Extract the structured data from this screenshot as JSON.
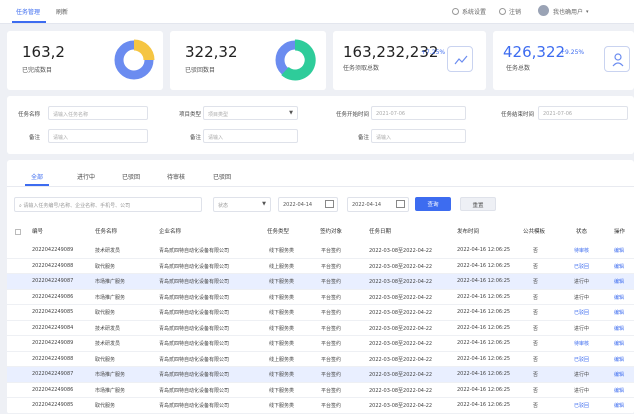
{
  "nav": {
    "tab1": "任务管理",
    "tab2": "刷新",
    "settings": "系统设置",
    "logout": "注销",
    "user": "我也确用户"
  },
  "cards": [
    {
      "value": "163,2",
      "label": "已完成数目"
    },
    {
      "value": "322,32",
      "label": "已驳回数目"
    },
    {
      "value": "163,232,232",
      "pct": "+7.25%",
      "label": "任务须取总数"
    },
    {
      "value": "426,322",
      "pct": "+9.25%",
      "label": "任务总数"
    }
  ],
  "filters": {
    "name_label": "任务名称",
    "name_ph": "请输入任务名称",
    "type_label": "项目类型",
    "type_ph": "项目类型",
    "start_label": "任务开始时间",
    "start_val": "2021-07-06",
    "end_label": "任务结束时间",
    "end_val": "2021-07-06",
    "note1_label": "备注",
    "note1_ph": "请输入",
    "note2_label": "备注",
    "note2_ph": "请输入",
    "note3_label": "备注",
    "note3_ph": "请输入"
  },
  "tabs": [
    "全部",
    "进行中",
    "已驳回",
    "待审核",
    "已驳回"
  ],
  "search": {
    "placeholder": "请输入任务编号/名称、企业名称、手机号、公司",
    "status": "状态",
    "date1": "2022-04-14",
    "date2": "2022-04-14",
    "query": "查询",
    "reset": "重置"
  },
  "colors": {
    "accent": "#3d6cf0",
    "pie1": "#6b8cf0",
    "pie2": "#f5c543",
    "pie3": "#2ecc9a"
  },
  "headers": [
    "编号",
    "任务名称",
    "企业名称",
    "任务类型",
    "签约对象",
    "任务日期",
    "发布时间",
    "公共模板",
    "状态",
    "操作"
  ],
  "rows": [
    [
      "2022042249089",
      "技术研发员",
      "青岛贰四特自动化设备有限公司",
      "线下服务类",
      "平台签约",
      "2022-03-08至2022-04-22",
      "2022-04-16 12:06:25",
      "否",
      "待审核",
      "编辑"
    ],
    [
      "2022042249088",
      "取代服务",
      "青岛贰四特自动化设备有限公司",
      "线上服务类",
      "平台签约",
      "2022-03-08至2022-04-22",
      "2022-04-16 12:06:25",
      "否",
      "已驳回",
      "编辑"
    ],
    [
      "2022042249087",
      "市场推广服务",
      "青岛贰四特自动化设备有限公司",
      "线下服务类",
      "平台签约",
      "2022-03-08至2022-04-22",
      "2022-04-16 12:06:25",
      "否",
      "进行中",
      "编辑"
    ],
    [
      "2022042249086",
      "市场推广服务",
      "青岛贰四特自动化设备有限公司",
      "线下服务类",
      "平台签约",
      "2022-03-08至2022-04-22",
      "2022-04-16 12:06:25",
      "否",
      "进行中",
      "编辑"
    ],
    [
      "2022042249085",
      "取代服务",
      "青岛贰四特自动化设备有限公司",
      "线下服务类",
      "平台签约",
      "2022-03-08至2022-04-22",
      "2022-04-16 12:06:25",
      "否",
      "已驳回",
      "编辑"
    ],
    [
      "2022042249084",
      "技术研发员",
      "青岛贰四特自动化设备有限公司",
      "线下服务类",
      "平台签约",
      "2022-03-08至2022-04-22",
      "2022-04-16 12:06:25",
      "否",
      "进行中",
      "编辑"
    ],
    [
      "2022042249089",
      "技术研发员",
      "青岛贰四特自动化设备有限公司",
      "线下服务类",
      "平台签约",
      "2022-03-08至2022-04-22",
      "2022-04-16 12:06:25",
      "否",
      "待审核",
      "编辑"
    ],
    [
      "2022042249088",
      "取代服务",
      "青岛贰四特自动化设备有限公司",
      "线上服务类",
      "平台签约",
      "2022-03-08至2022-04-22",
      "2022-04-16 12:06:25",
      "否",
      "已驳回",
      "编辑"
    ],
    [
      "2022042249087",
      "市场推广服务",
      "青岛贰四特自动化设备有限公司",
      "线下服务类",
      "平台签约",
      "2022-03-08至2022-04-22",
      "2022-04-16 12:06:25",
      "否",
      "进行中",
      "编辑"
    ],
    [
      "2022042249086",
      "市场推广服务",
      "青岛贰四特自动化设备有限公司",
      "线下服务类",
      "平台签约",
      "2022-03-08至2022-04-22",
      "2022-04-16 12:06:25",
      "否",
      "进行中",
      "编辑"
    ],
    [
      "2022042249085",
      "取代服务",
      "青岛贰四特自动化设备有限公司",
      "线下服务类",
      "平台签约",
      "2022-03-08至2022-04-22",
      "2022-04-16 12:06:25",
      "否",
      "已驳回",
      "编辑"
    ]
  ]
}
